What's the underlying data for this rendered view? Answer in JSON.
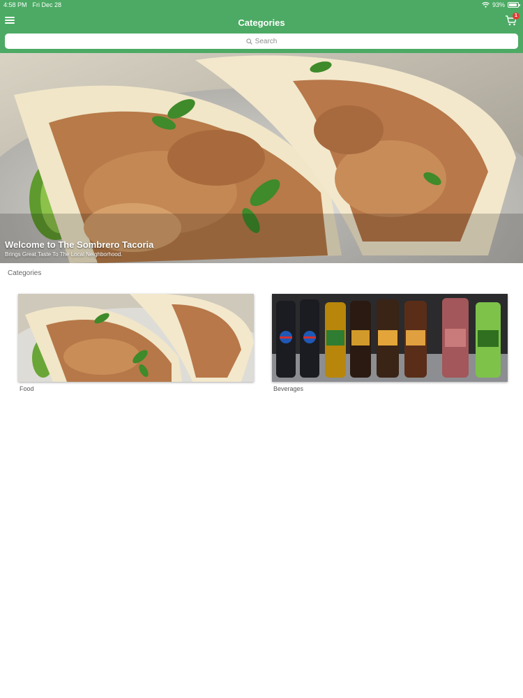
{
  "status_bar": {
    "time": "4:58 PM",
    "date": "Fri Dec 28",
    "battery": "93%",
    "battery_level": 0.93
  },
  "header": {
    "title": "Categories",
    "menu_icon": "hamburger-icon",
    "cart_icon": "cart-icon",
    "cart_badge": "1"
  },
  "search": {
    "placeholder": "Search",
    "icon": "search-icon"
  },
  "hero": {
    "title": "Welcome to The Sombrero Tacoria",
    "subtitle": "Brings Great Taste To The Local Neighborhood."
  },
  "section": {
    "title": "Categories"
  },
  "categories": [
    {
      "label": "Food"
    },
    {
      "label": "Beverages"
    }
  ],
  "colors": {
    "brand_green": "#4caa64",
    "badge_red": "#e53935"
  }
}
